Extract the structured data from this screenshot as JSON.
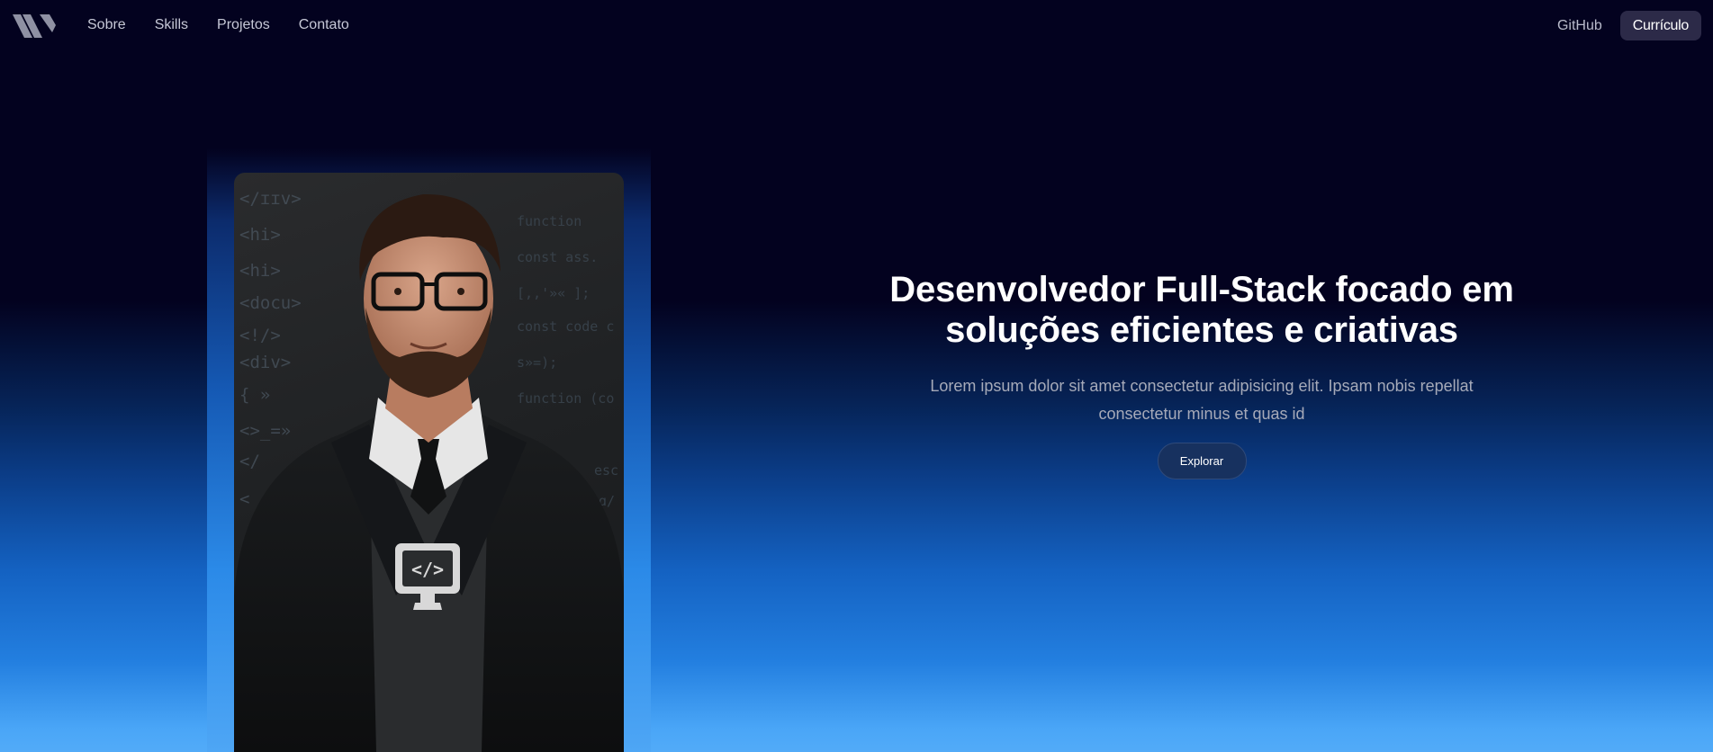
{
  "nav": {
    "logo_icon": "brand-logo-icon",
    "links": [
      {
        "label": "Sobre"
      },
      {
        "label": "Skills"
      },
      {
        "label": "Projetos"
      },
      {
        "label": "Contato"
      }
    ],
    "github_label": "GitHub",
    "cv_label": "Currículo"
  },
  "hero": {
    "title_line1": "Desenvolvedor Full-Stack focado em",
    "title_line2": "soluções eficientes e criativas",
    "description": "Lorem ipsum dolor sit amet consectetur adipisicing elit. Ipsam nobis repellat consectetur minus et quas id",
    "explore_label": "Explorar"
  },
  "photo": {
    "description_icon": "developer-portrait-photo",
    "code_left": [
      "</ɪɪv>",
      "<hi>",
      "<hi>",
      "<docu>",
      "<!/>",
      "<div>",
      "{ »",
      "<>_=»",
      "</",
      "<"
    ],
    "code_right": [
      "function",
      "const ass.",
      "[,,'»« ];",
      "const code c",
      "s»=);",
      "function (co",
      "",
      "",
      "esc",
      "ɑ/"
    ]
  },
  "colors": {
    "background_top": "#03021f",
    "background_bottom": "#52abf8",
    "cv_button_bg": "#2c2a48",
    "explore_button_bg": "#17315f"
  }
}
